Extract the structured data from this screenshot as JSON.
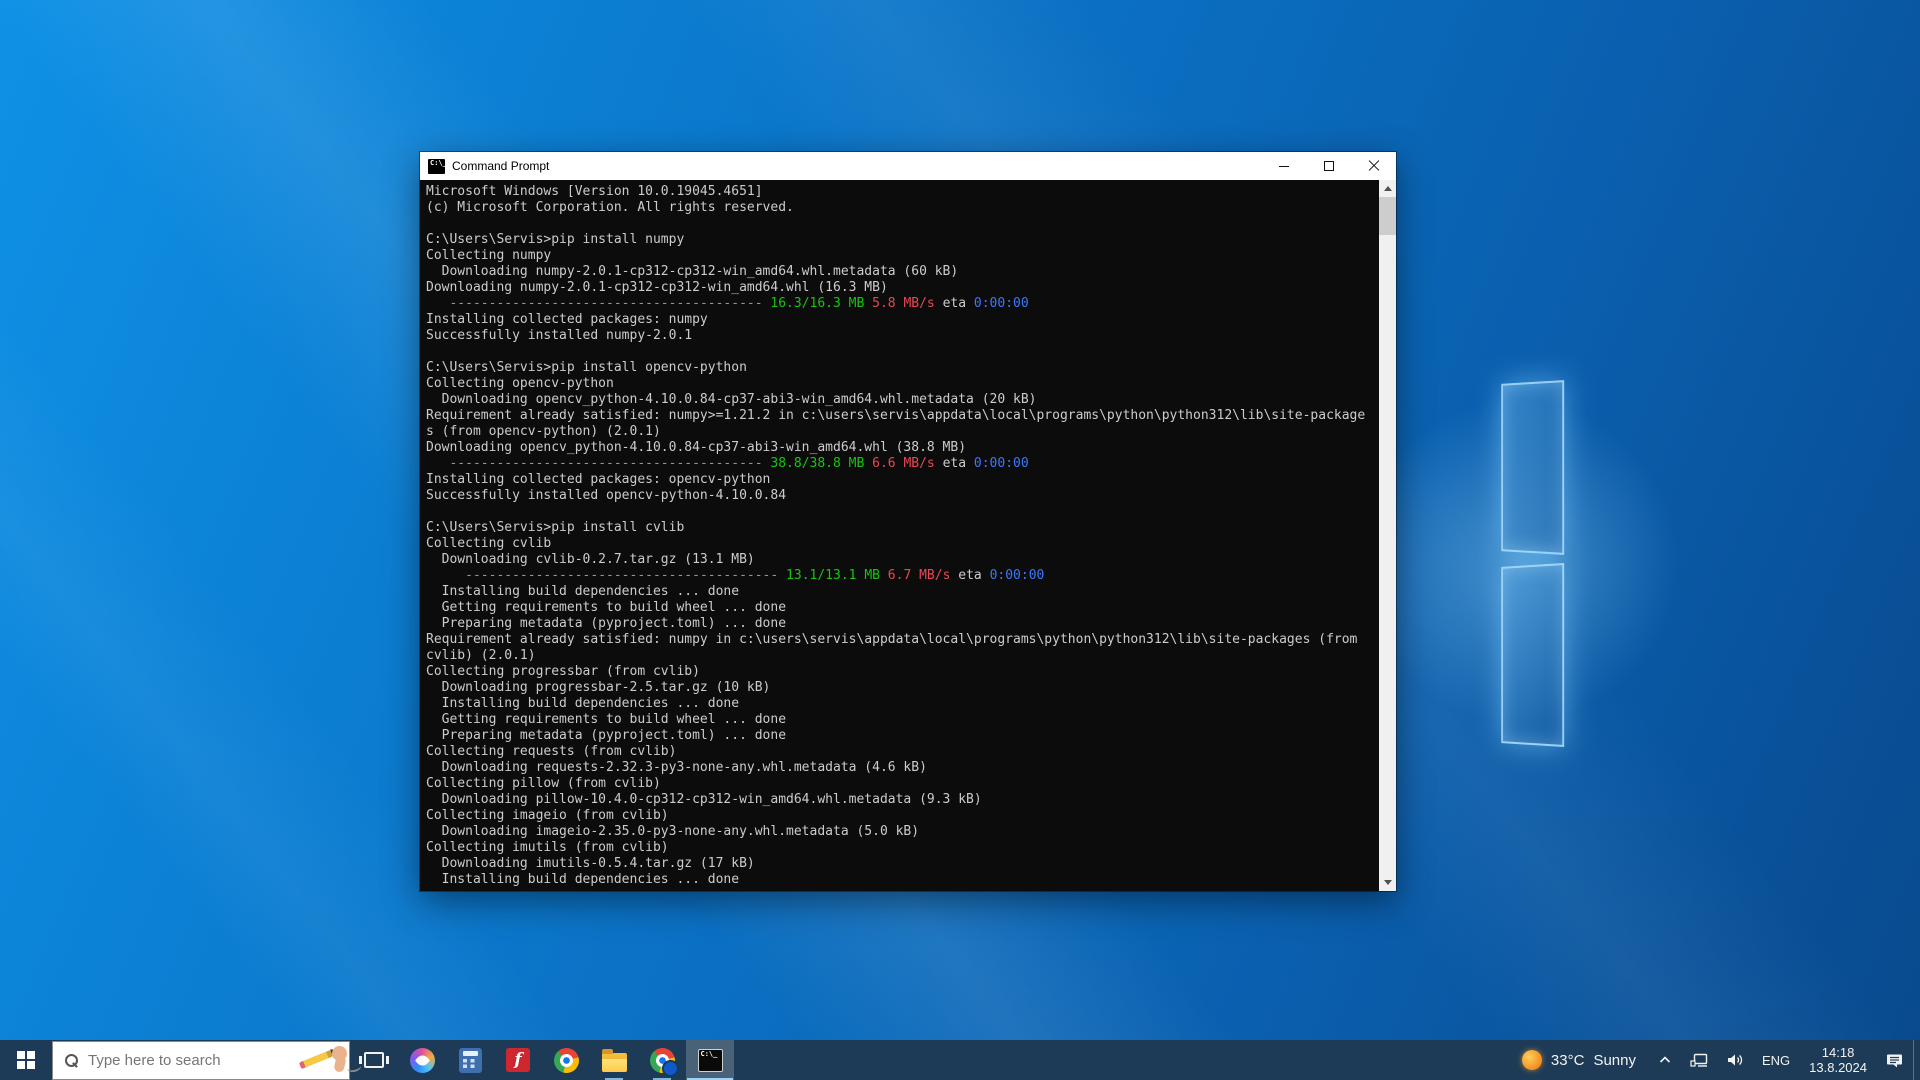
{
  "palette": {
    "taskbar_bg": "#1d3b57",
    "terminal_bg": "#0c0c0c",
    "terminal_fg": "#cccccc",
    "ansi_yellow": "#c19c00",
    "ansi_green": "#16c60c",
    "ansi_red": "#e74856",
    "ansi_blue": "#3b78ff",
    "titlebar_bg": "#ffffff",
    "run_indicator": "#82b6dd"
  },
  "window": {
    "title": "Command Prompt",
    "icon_glyph": "C:\\_",
    "controls": {
      "minimize": "minimize",
      "maximize": "maximize",
      "close": "close"
    }
  },
  "terminal": {
    "columns": 120,
    "lines": [
      [
        {
          "t": "Microsoft Windows [Version 10.0.19045.4651]",
          "c": "fg"
        }
      ],
      [
        {
          "t": "(c) Microsoft Corporation. All rights reserved.",
          "c": "fg"
        }
      ],
      [],
      [
        {
          "t": "C:\\Users\\Servis>pip install numpy",
          "c": "fg"
        }
      ],
      [
        {
          "t": "Collecting numpy",
          "c": "fg"
        }
      ],
      [
        {
          "t": "  Downloading numpy-2.0.1-cp312-cp312-win_amd64.whl.metadata (60 kB)",
          "c": "fg"
        }
      ],
      [
        {
          "t": "Downloading numpy-2.0.1-cp312-cp312-win_amd64.whl (16.3 MB)",
          "c": "fg"
        }
      ],
      [
        {
          "t": "   ",
          "c": "fg"
        },
        {
          "t": "---------------------------------------- ",
          "c": "y"
        },
        {
          "t": "16.3/16.3 MB",
          "c": "g"
        },
        {
          "t": " ",
          "c": "fg"
        },
        {
          "t": "5.8 MB/s",
          "c": "r"
        },
        {
          "t": " eta ",
          "c": "fg"
        },
        {
          "t": "0:00:00",
          "c": "b"
        }
      ],
      [
        {
          "t": "Installing collected packages: numpy",
          "c": "fg"
        }
      ],
      [
        {
          "t": "Successfully installed numpy-2.0.1",
          "c": "fg"
        }
      ],
      [],
      [
        {
          "t": "C:\\Users\\Servis>pip install opencv-python",
          "c": "fg"
        }
      ],
      [
        {
          "t": "Collecting opencv-python",
          "c": "fg"
        }
      ],
      [
        {
          "t": "  Downloading opencv_python-4.10.0.84-cp37-abi3-win_amd64.whl.metadata (20 kB)",
          "c": "fg"
        }
      ],
      [
        {
          "t": "Requirement already satisfied: numpy>=1.21.2 in c:\\users\\servis\\appdata\\local\\programs\\python\\python312\\lib\\site-package",
          "c": "fg"
        }
      ],
      [
        {
          "t": "s (from opencv-python) (2.0.1)",
          "c": "fg"
        }
      ],
      [
        {
          "t": "Downloading opencv_python-4.10.0.84-cp37-abi3-win_amd64.whl (38.8 MB)",
          "c": "fg"
        }
      ],
      [
        {
          "t": "   ",
          "c": "fg"
        },
        {
          "t": "---------------------------------------- ",
          "c": "y"
        },
        {
          "t": "38.8/38.8 MB",
          "c": "g"
        },
        {
          "t": " ",
          "c": "fg"
        },
        {
          "t": "6.6 MB/s",
          "c": "r"
        },
        {
          "t": " eta ",
          "c": "fg"
        },
        {
          "t": "0:00:00",
          "c": "b"
        }
      ],
      [
        {
          "t": "Installing collected packages: opencv-python",
          "c": "fg"
        }
      ],
      [
        {
          "t": "Successfully installed opencv-python-4.10.0.84",
          "c": "fg"
        }
      ],
      [],
      [
        {
          "t": "C:\\Users\\Servis>pip install cvlib",
          "c": "fg"
        }
      ],
      [
        {
          "t": "Collecting cvlib",
          "c": "fg"
        }
      ],
      [
        {
          "t": "  Downloading cvlib-0.2.7.tar.gz (13.1 MB)",
          "c": "fg"
        }
      ],
      [
        {
          "t": "     ",
          "c": "fg"
        },
        {
          "t": "---------------------------------------- ",
          "c": "y"
        },
        {
          "t": "13.1/13.1 MB",
          "c": "g"
        },
        {
          "t": " ",
          "c": "fg"
        },
        {
          "t": "6.7 MB/s",
          "c": "r"
        },
        {
          "t": " eta ",
          "c": "fg"
        },
        {
          "t": "0:00:00",
          "c": "b"
        }
      ],
      [
        {
          "t": "  Installing build dependencies ... done",
          "c": "fg"
        }
      ],
      [
        {
          "t": "  Getting requirements to build wheel ... done",
          "c": "fg"
        }
      ],
      [
        {
          "t": "  Preparing metadata (pyproject.toml) ... done",
          "c": "fg"
        }
      ],
      [
        {
          "t": "Requirement already satisfied: numpy in c:\\users\\servis\\appdata\\local\\programs\\python\\python312\\lib\\site-packages (from",
          "c": "fg"
        }
      ],
      [
        {
          "t": "cvlib) (2.0.1)",
          "c": "fg"
        }
      ],
      [
        {
          "t": "Collecting progressbar (from cvlib)",
          "c": "fg"
        }
      ],
      [
        {
          "t": "  Downloading progressbar-2.5.tar.gz (10 kB)",
          "c": "fg"
        }
      ],
      [
        {
          "t": "  Installing build dependencies ... done",
          "c": "fg"
        }
      ],
      [
        {
          "t": "  Getting requirements to build wheel ... done",
          "c": "fg"
        }
      ],
      [
        {
          "t": "  Preparing metadata (pyproject.toml) ... done",
          "c": "fg"
        }
      ],
      [
        {
          "t": "Collecting requests (from cvlib)",
          "c": "fg"
        }
      ],
      [
        {
          "t": "  Downloading requests-2.32.3-py3-none-any.whl.metadata (4.6 kB)",
          "c": "fg"
        }
      ],
      [
        {
          "t": "Collecting pillow (from cvlib)",
          "c": "fg"
        }
      ],
      [
        {
          "t": "  Downloading pillow-10.4.0-cp312-cp312-win_amd64.whl.metadata (9.3 kB)",
          "c": "fg"
        }
      ],
      [
        {
          "t": "Collecting imageio (from cvlib)",
          "c": "fg"
        }
      ],
      [
        {
          "t": "  Downloading imageio-2.35.0-py3-none-any.whl.metadata (5.0 kB)",
          "c": "fg"
        }
      ],
      [
        {
          "t": "Collecting imutils (from cvlib)",
          "c": "fg"
        }
      ],
      [
        {
          "t": "  Downloading imutils-0.5.4.tar.gz (17 kB)",
          "c": "fg"
        }
      ],
      [
        {
          "t": "  Installing build dependencies ... done",
          "c": "fg"
        }
      ]
    ]
  },
  "taskbar": {
    "search": {
      "placeholder": "Type here to search"
    },
    "apps": [
      {
        "name": "task-view",
        "running": false,
        "active": false
      },
      {
        "name": "copilot",
        "running": false,
        "active": false
      },
      {
        "name": "calculator",
        "running": false,
        "active": false
      },
      {
        "name": "red-f-app",
        "glyph": "f",
        "running": false,
        "active": false
      },
      {
        "name": "chrome",
        "running": false,
        "active": false
      },
      {
        "name": "file-explorer",
        "running": true,
        "active": false
      },
      {
        "name": "chrome-profile",
        "running": true,
        "active": false
      },
      {
        "name": "command-prompt",
        "glyph": "C:\\_",
        "running": true,
        "active": true
      }
    ],
    "tray": {
      "weather": {
        "temp": "33°C",
        "condition": "Sunny"
      },
      "language": "ENG",
      "clock": {
        "time": "14:18",
        "date": "13.8.2024"
      }
    }
  }
}
